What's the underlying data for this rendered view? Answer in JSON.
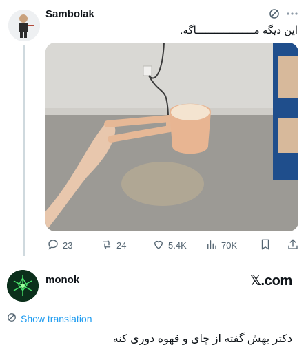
{
  "post1": {
    "username": "Sambolak",
    "text": "این دیگه مـــــــــــــــــــاگه.",
    "metrics": {
      "replies": "23",
      "reposts": "24",
      "likes": "5.4K",
      "views": "70K"
    }
  },
  "post2": {
    "username": "monok",
    "brand": "𝕏.com",
    "show_translation": "Show translation",
    "text": "دکتر بهش گفته از چای و قهوه دوری کنه"
  },
  "icons": {
    "grok": "grok-icon",
    "more": "more-icon",
    "reply": "reply-icon",
    "repost": "repost-icon",
    "like": "like-icon",
    "views": "views-icon",
    "bookmark": "bookmark-icon",
    "share": "share-icon",
    "translate": "translate-icon"
  },
  "colors": {
    "link": "#1d9bf0",
    "muted": "#536471",
    "text": "#0f1419"
  }
}
